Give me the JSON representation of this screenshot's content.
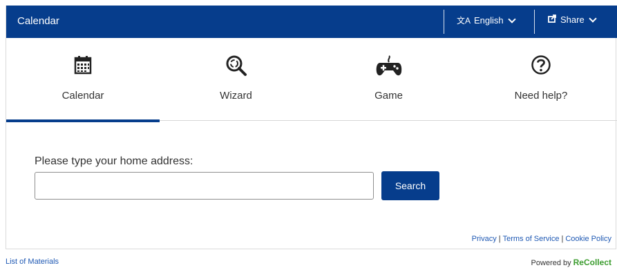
{
  "header": {
    "title": "Calendar",
    "language_label": "English",
    "share_label": "Share",
    "language_icon": "translate-icon",
    "share_icon": "share-icon"
  },
  "tabs": [
    {
      "label": "Calendar",
      "icon": "calendar-icon",
      "active": true
    },
    {
      "label": "Wizard",
      "icon": "magnifier-recycle-icon",
      "active": false
    },
    {
      "label": "Game",
      "icon": "gamepad-icon",
      "active": false
    },
    {
      "label": "Need help?",
      "icon": "help-icon",
      "active": false
    }
  ],
  "form": {
    "label": "Please type your home address:",
    "input_value": "",
    "input_placeholder": "",
    "search_label": "Search"
  },
  "legal": {
    "privacy": "Privacy",
    "terms": "Terms of Service",
    "cookie": "Cookie Policy",
    "separator": "|"
  },
  "footer": {
    "materials_link": "List of Materials",
    "powered_by": "Powered by",
    "brand": "ReCollect"
  },
  "colors": {
    "primary": "#063d8c",
    "link": "#1e58b3",
    "brand_green": "#3c9d2f"
  }
}
